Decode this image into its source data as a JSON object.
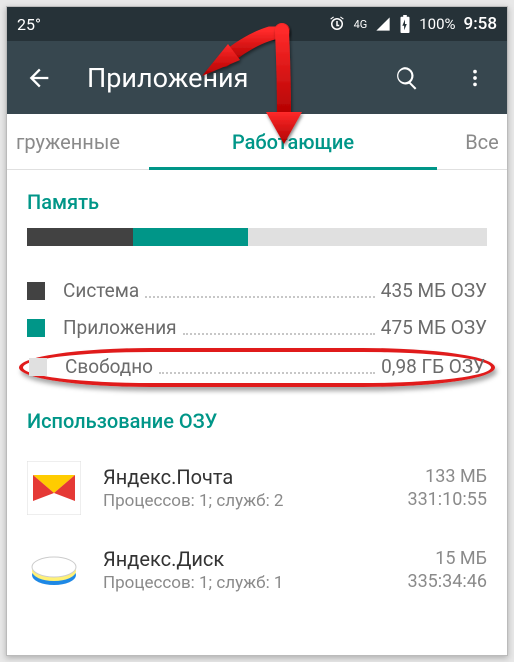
{
  "statusbar": {
    "temp": "25°",
    "network": "4G",
    "battery": "100%",
    "time": "9:58"
  },
  "appbar": {
    "title": "Приложения"
  },
  "tabs": {
    "left": "груженные",
    "center": "Работающие",
    "right": "Все"
  },
  "memory": {
    "title": "Память",
    "rows": [
      {
        "label": "Система",
        "value": "435 МБ ОЗУ"
      },
      {
        "label": "Приложения",
        "value": "475 МБ ОЗУ"
      },
      {
        "label": "Свободно",
        "value": "0,98 ГБ ОЗУ"
      }
    ]
  },
  "ramUsage": {
    "title": "Использование ОЗУ",
    "apps": [
      {
        "name": "Яндекс.Почта",
        "sub": "Процессов: 1; служб: 2",
        "ram": "133 МБ",
        "time": "331:10:55"
      },
      {
        "name": "Яндекс.Диск",
        "sub": "Процессов: 1; служб: 1",
        "ram": "15 МБ",
        "time": "335:34:46"
      }
    ]
  }
}
